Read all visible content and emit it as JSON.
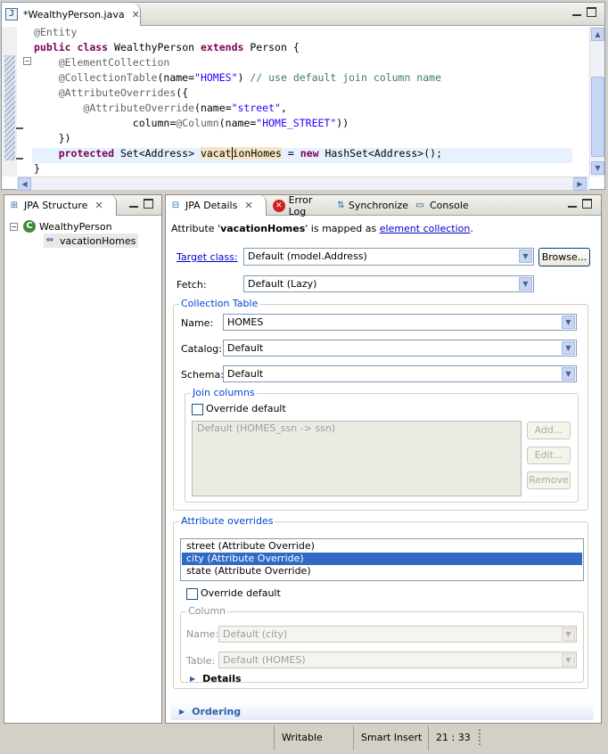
{
  "editor": {
    "tab_title": "*WealthyPerson.java",
    "code": {
      "l1_annot": "@Entity",
      "l2_kw1": "public",
      "l2_kw2": "class",
      "l2_name": " WealthyPerson ",
      "l2_kw3": "extends",
      "l2_rest": " Person {",
      "l3_annot": "@ElementCollection",
      "l4_annot": "@CollectionTable",
      "l4_open": "(name=",
      "l4_str": "\"HOMES\"",
      "l4_close": ") ",
      "l4_comment": "// use default join column name",
      "l5_annot": "@AttributeOverrides",
      "l5_rest": "({",
      "l6_annot": "@AttributeOverride",
      "l6_open": "(name=",
      "l6_str": "\"street\"",
      "l6_close": ",",
      "l7_pre": "column=",
      "l7_annot": "@Column",
      "l7_open": "(name=",
      "l7_str": "\"HOME_STREET\"",
      "l7_close": "))",
      "l8": "})",
      "l9_kw1": "protected",
      "l9_type": " Set<Address> ",
      "l9_var_a": "vacat",
      "l9_var_b": "ionHomes",
      "l9_eq": " = ",
      "l9_kw2": "new",
      "l9_rest": " HashSet<Address>();",
      "l10": "}"
    }
  },
  "structure_view": {
    "tab_label": "JPA Structure",
    "tree": {
      "root": "WealthyPerson",
      "child": "vacationHomes"
    }
  },
  "details_view": {
    "tabs": [
      "JPA Details",
      "Error Log",
      "Synchronize",
      "Console"
    ],
    "mapping": {
      "prefix": "Attribute '",
      "attr": "vacationHomes",
      "middle": "' is mapped as ",
      "link": "element collection",
      "suffix": "."
    },
    "target_class": {
      "label": "Target class:",
      "value": "Default (model.Address)",
      "browse": "Browse..."
    },
    "fetch": {
      "label": "Fetch:",
      "value": "Default (Lazy)"
    },
    "collection_table": {
      "title": "Collection Table",
      "name_label": "Name:",
      "name_value": "HOMES",
      "catalog_label": "Catalog:",
      "catalog_value": "Default",
      "schema_label": "Schema:",
      "schema_value": "Default",
      "join_columns": {
        "title": "Join columns",
        "override_label": "Override default",
        "list_item": "Default (HOMES_ssn -> ssn)",
        "add": "Add...",
        "edit": "Edit...",
        "remove": "Remove"
      }
    },
    "attribute_overrides": {
      "title": "Attribute overrides",
      "items": [
        "street (Attribute Override)",
        "city (Attribute Override)",
        "state (Attribute Override)"
      ],
      "selected_index": 1,
      "override_label": "Override default",
      "column": {
        "title": "Column",
        "name_label": "Name:",
        "name_value": "Default (city)",
        "table_label": "Table:",
        "table_value": "Default (HOMES)",
        "details": "Details"
      }
    },
    "ordering": "Ordering"
  },
  "status_bar": {
    "writable": "Writable",
    "insert_mode": "Smart Insert",
    "position": "21 : 33"
  },
  "colors": {
    "keyword": "#7f0055",
    "string": "#2a00ff",
    "comment": "#3f7f5f",
    "annotation": "#646464",
    "selection": "#316ac5",
    "group_title": "#0046d5"
  }
}
